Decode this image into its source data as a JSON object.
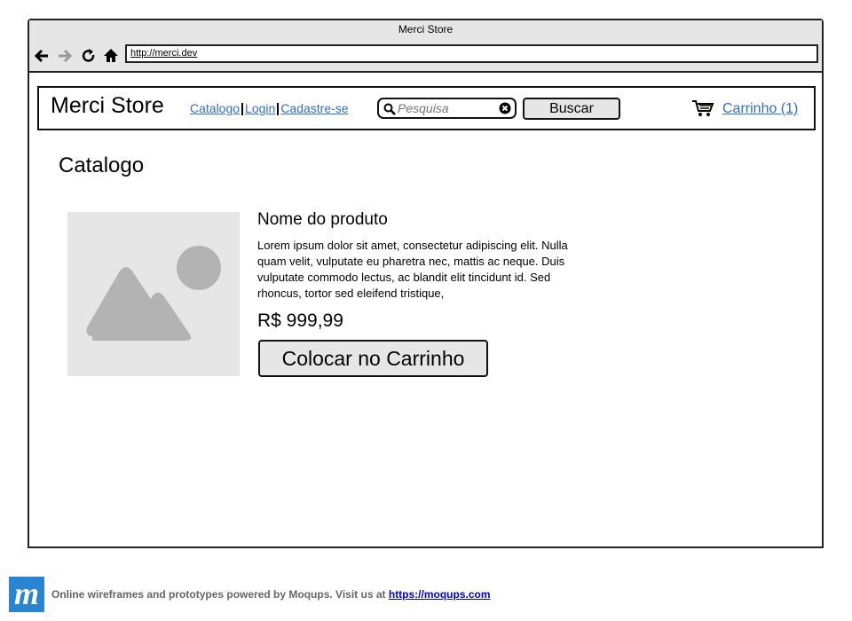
{
  "browser": {
    "window_title": "Merci Store",
    "url": "http://merci.dev",
    "nav": {
      "back_icon": "arrow-left-icon",
      "forward_icon": "arrow-right-icon",
      "reload_icon": "reload-icon",
      "home_icon": "home-icon"
    }
  },
  "header": {
    "brand": "Merci Store",
    "links": [
      "Catalogo",
      "Login",
      "Cadastre-se"
    ],
    "search": {
      "placeholder": "Pesquisa",
      "value": ""
    },
    "search_button": "Buscar",
    "cart_link": "Carrinho (1)"
  },
  "main": {
    "title": "Catalogo",
    "product": {
      "name": "Nome do produto",
      "description": "Lorem ipsum dolor sit amet, consectetur adipiscing elit. Nulla quam velit, vulputate eu pharetra nec, mattis ac neque. Duis vulputate commodo lectus, ac blandit elit tincidunt id. Sed rhoncus, tortor sed eleifend tristique,",
      "price": "R$ 999,99",
      "add_button": "Colocar no Carrinho"
    }
  },
  "footer": {
    "logo_letter": "m",
    "text": "Online wireframes and prototypes powered by Moqups. Visit us at ",
    "link": "https://moqups.com"
  },
  "colors": {
    "link": "#2f6fce",
    "chrome_bg": "#e6e6e6",
    "placeholder_img": "#e6e6e6",
    "placeholder_shape": "#b3b3b3",
    "footer_logo": "#2a84d0"
  }
}
